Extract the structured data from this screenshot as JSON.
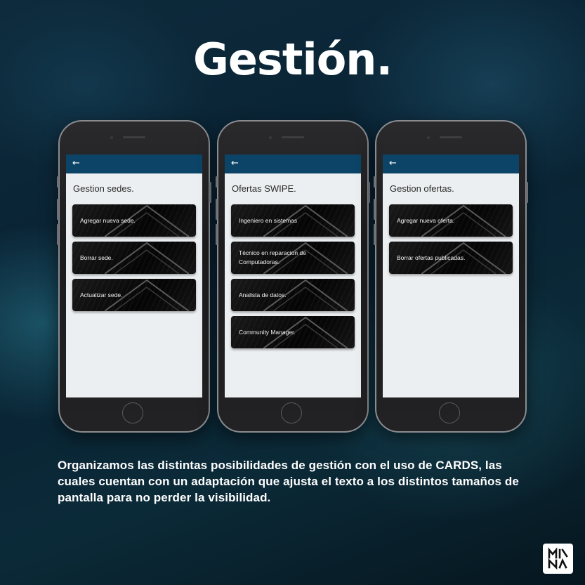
{
  "title": "Gestión.",
  "phones": [
    {
      "screen_title": "Gestion sedes.",
      "back_icon": "arrow-left-icon",
      "cards": [
        "Agregar nueva sede.",
        "Borrar sede.",
        "Actualizar sede."
      ]
    },
    {
      "screen_title": "Ofertas SWIPE.",
      "back_icon": "arrow-left-icon",
      "cards": [
        "Ingeniero en sistemas",
        "Técnico en reparacion de Computadoras.",
        "Analista de datos.",
        "Community Manager."
      ]
    },
    {
      "screen_title": "Gestion ofertas.",
      "back_icon": "arrow-left-icon",
      "cards": [
        "Agregar nueva oferta.",
        "Borrar ofertas publicadas."
      ]
    }
  ],
  "caption": "Organizamos las distintas posibilidades de gestión con el uso de CARDS, las cuales cuentan con un adaptación que ajusta el texto a los distintos tamaños de pantalla para no perder la visibilidad.",
  "colors": {
    "appbar": "#0b4466",
    "screen_bg": "#eceff1",
    "card_bg": "#0a0a0a"
  }
}
